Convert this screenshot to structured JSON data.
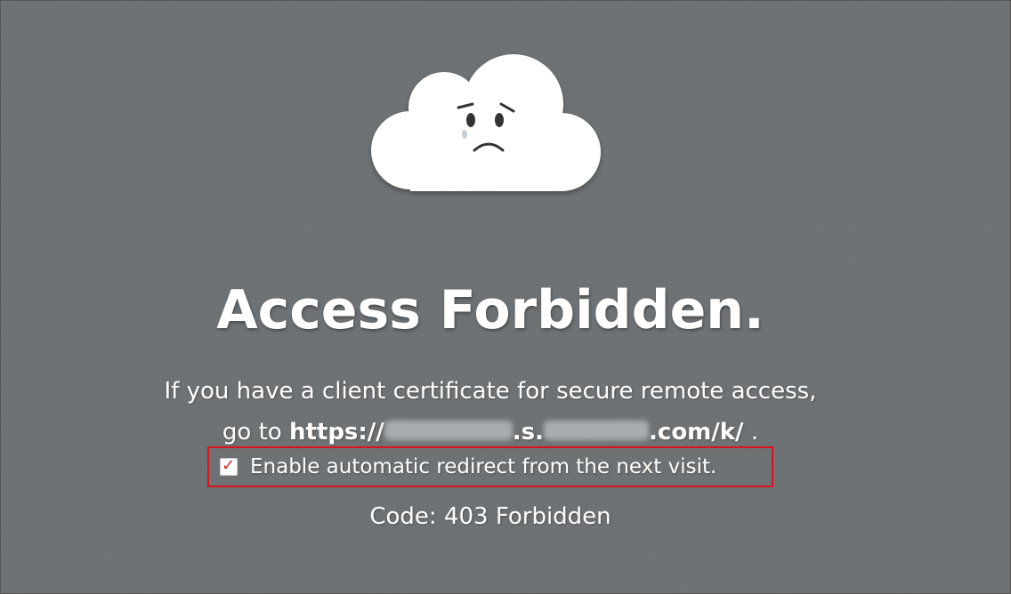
{
  "illustration": {
    "icon": "sad-cloud-icon"
  },
  "title": "Access Forbidden.",
  "message": {
    "line1": "If you have a client certificate for secure remote access,",
    "line2_prefix": "go to ",
    "url_start": "https://",
    "url_mid": ".s.",
    "url_end": ".com/k/",
    "line2_suffix": " ."
  },
  "redirect": {
    "label": "Enable automatic redirect from the next visit.",
    "checked": true,
    "check_glyph": "✓",
    "highlight_color": "#d9121b",
    "check_color": "#e0211b"
  },
  "status": {
    "code_text": "Code: 403 Forbidden"
  },
  "colors": {
    "background": "#6e7275",
    "text": "#ffffff"
  }
}
